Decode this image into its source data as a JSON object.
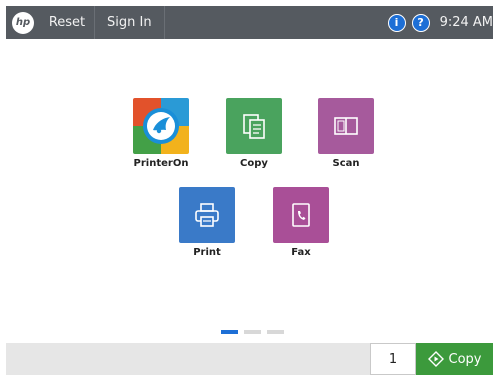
{
  "header": {
    "logo": "hp",
    "reset_label": "Reset",
    "signin_label": "Sign In",
    "info_icon": "i",
    "help_icon": "?",
    "time": "9:24 AM"
  },
  "apps": [
    {
      "label": "PrinterOn",
      "icon": "printeron-bird-icon",
      "color": "#1a8fd8"
    },
    {
      "label": "Copy",
      "icon": "copy-icon",
      "color": "#4aa35e"
    },
    {
      "label": "Scan",
      "icon": "scan-icon",
      "color": "#a65a9c"
    },
    {
      "label": "Print",
      "icon": "print-icon",
      "color": "#3a7ac8"
    },
    {
      "label": "Fax",
      "icon": "fax-icon",
      "color": "#a94f97"
    }
  ],
  "pagination": {
    "pages": 3,
    "current": 1
  },
  "footer": {
    "copies": "1",
    "copy_label": "Copy",
    "copy_color": "#3c9a3c"
  }
}
